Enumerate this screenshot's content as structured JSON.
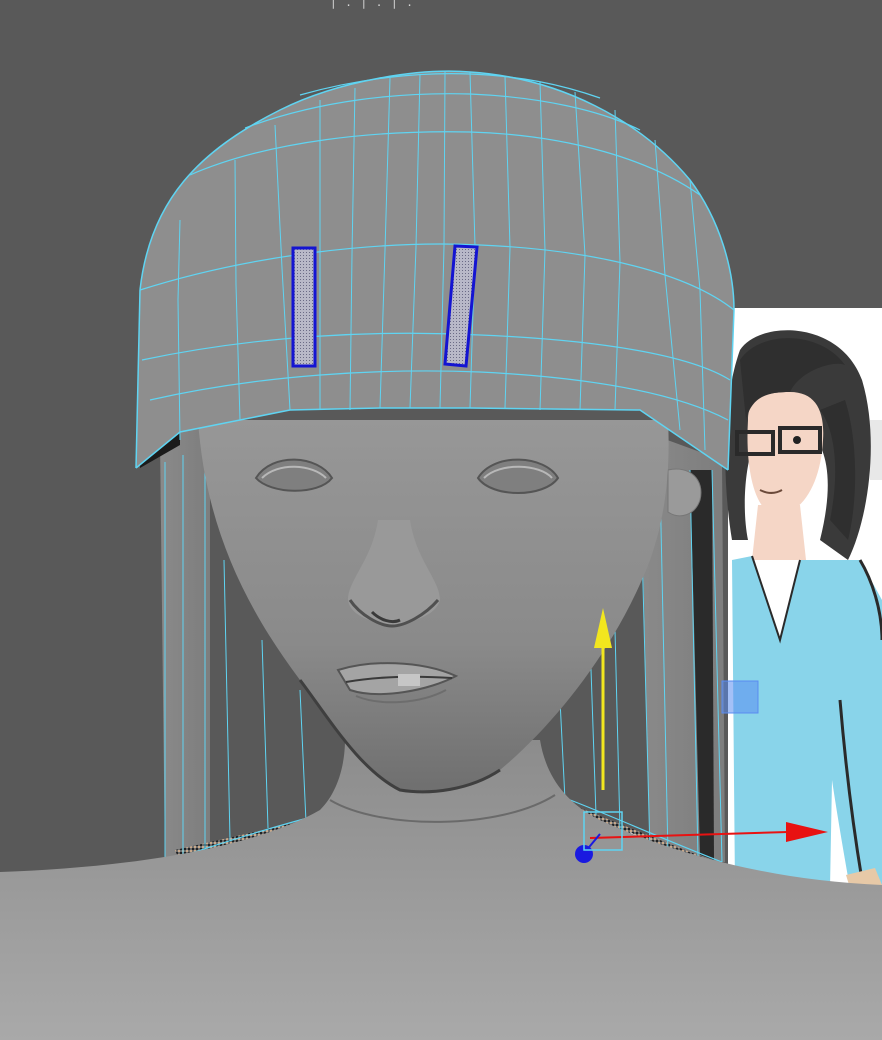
{
  "viewport": {
    "name": "3d-viewport",
    "background_color": "#595959",
    "top_label": "| . | . | ."
  },
  "colors": {
    "wireframe": "#5fd4f2",
    "selected_face": "#1414d2",
    "manipulator_y": "#f2e61e",
    "manipulator_x": "#e81212",
    "manipulator_z": "#1a1ae0",
    "plane_handle": "#5a8cf0",
    "mesh_gray": "#8f8f8f"
  },
  "icons": {
    "move_manipulator": "move-manipulator-icon",
    "y_arrow": "y-axis-arrow-icon",
    "x_arrow": "x-axis-arrow-icon",
    "z_handle": "z-axis-handle-icon",
    "plane_handle": "plane-handle-icon"
  }
}
